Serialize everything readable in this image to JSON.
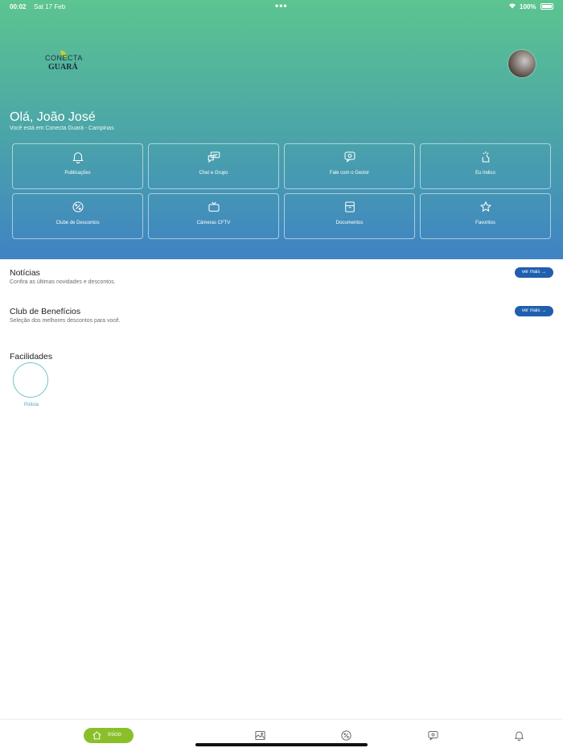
{
  "status_bar": {
    "time": "00:02",
    "date": "Sat 17 Feb",
    "battery": "100%"
  },
  "header": {
    "logo": {
      "line1": "CONECTA",
      "line2": "GUARÁ"
    },
    "greeting": "Olá, João José",
    "location": "Você está em Conecta Guará - Campinas"
  },
  "tiles": [
    {
      "label": "Publicações",
      "icon": "bell-icon"
    },
    {
      "label": "Chat e Grupo",
      "icon": "chat-icon"
    },
    {
      "label": "Fale com o Gestor",
      "icon": "message-icon"
    },
    {
      "label": "Eu indico",
      "icon": "hand-icon"
    },
    {
      "label": "Clube de Descontos",
      "icon": "discount-icon"
    },
    {
      "label": "Câmeras CFTV",
      "icon": "tv-icon"
    },
    {
      "label": "Documentos",
      "icon": "archive-icon"
    },
    {
      "label": "Favoritos",
      "icon": "star-icon"
    }
  ],
  "sections": {
    "news": {
      "title": "Notícias",
      "subtitle": "Confira as últimas novidades e descontos.",
      "action": "ver mais →"
    },
    "club": {
      "title": "Club de Benefícios",
      "subtitle": "Seleção dos melhores descontos para você.",
      "action": "ver mais →"
    },
    "facilities": {
      "title": "Facilidades",
      "items": [
        {
          "label": "Polícia"
        }
      ]
    }
  },
  "tabbar": {
    "home_label": "Início",
    "icons": [
      "home-icon",
      "image-icon",
      "discount-icon",
      "message-icon",
      "bell-icon"
    ]
  },
  "colors": {
    "accent_green": "#8bbf2a",
    "button_blue": "#1f5fae",
    "gradient_top": "#5cc590",
    "gradient_bottom": "#3f83c4"
  }
}
